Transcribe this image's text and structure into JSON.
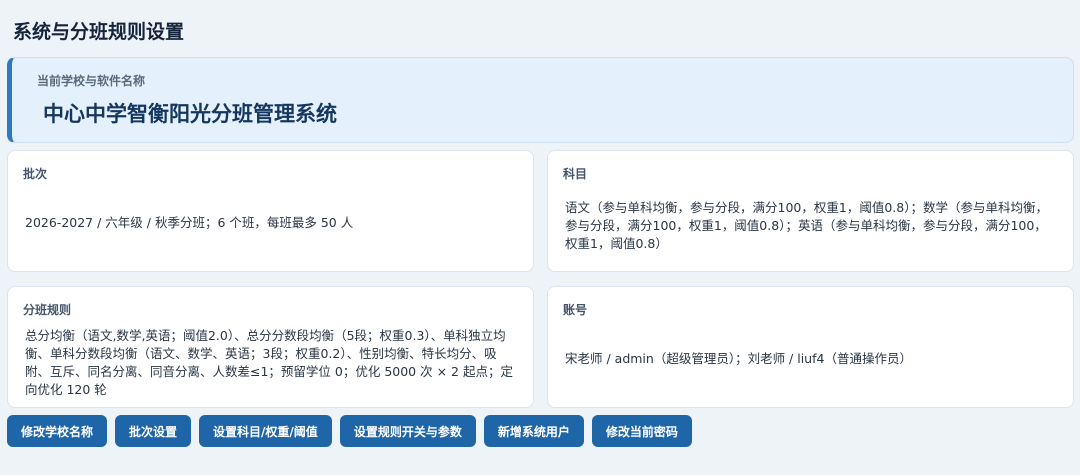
{
  "page": {
    "title": "系统与分班规则设置"
  },
  "school": {
    "label": "当前学校与软件名称",
    "name": "中心中学智衡阳光分班管理系统"
  },
  "cards": {
    "batch": {
      "title": "批次",
      "text": "2026-2027 / 六年级 / 秋季分班；6 个班，每班最多 50 人"
    },
    "subject": {
      "title": "科目",
      "text": "语文（参与单科均衡，参与分段，满分100，权重1，阈值0.8）；数学（参与单科均衡，参与分段，满分100，权重1，阈值0.8）；英语（参与单科均衡，参与分段，满分100，权重1，阈值0.8）"
    },
    "rules": {
      "title": "分班规则",
      "text": "总分均衡（语文,数学,英语；阈值2.0）、总分分数段均衡（5段；权重0.3）、单科独立均衡、单科分数段均衡（语文、数学、英语；3段；权重0.2）、性别均衡、特长均分、吸附、互斥、同名分离、同音分离、人数差≤1；预留学位 0；优化 5000 次 × 2 起点；定向优化 120 轮"
    },
    "account": {
      "title": "账号",
      "text": "宋老师 / admin（超级管理员）；刘老师 / liuf4（普通操作员）"
    }
  },
  "buttons": {
    "rename_school": "修改学校名称",
    "batch_settings": "批次设置",
    "subject_settings": "设置科目/权重/阈值",
    "rule_settings": "设置规则开关与参数",
    "add_user": "新增系统用户",
    "change_password": "修改当前密码"
  },
  "colors": {
    "accent": "#2f78c4",
    "button": "#1f66a8",
    "background": "#eef3f8"
  }
}
